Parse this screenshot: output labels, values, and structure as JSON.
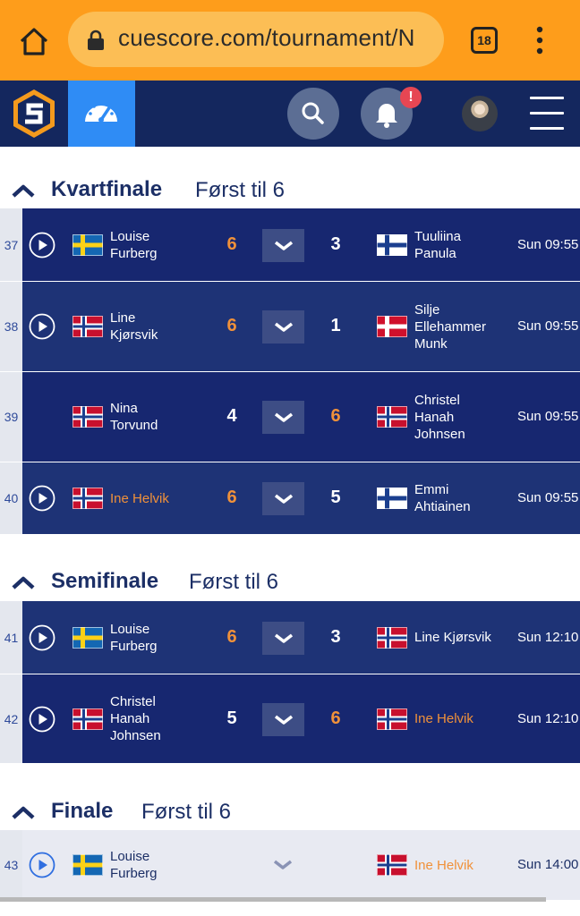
{
  "browser": {
    "url": "cuescore.com/tournament/N",
    "tab_count": "18"
  },
  "header": {
    "notification_badge": "!"
  },
  "colors": {
    "browser_bar": "#fe9d1b",
    "header_bg": "#14275e",
    "accent_blue": "#2f8cf5",
    "winner_orange": "#f0913a"
  },
  "sections": [
    {
      "title": "Kvartfinale",
      "rule": "Først til 6",
      "matches": [
        {
          "num": "37",
          "p1": "Louise\nFurberg",
          "p1_flag": "se",
          "s1": "6",
          "s2": "3",
          "p2": "Tuuliina\nPanula",
          "p2_flag": "fi",
          "time": "Sun 09:55",
          "has_play": true
        },
        {
          "num": "38",
          "p1": "Line\nKjørsvik",
          "p1_flag": "no",
          "s1": "6",
          "s2": "1",
          "p2": "Silje\nEllehammer\nMunk",
          "p2_flag": "dk",
          "time": "Sun 09:55",
          "has_play": true
        },
        {
          "num": "39",
          "p1": "Nina\nTorvund",
          "p1_flag": "no",
          "s1": "4",
          "s2": "6",
          "p2": "Christel\nHanah\nJohnsen",
          "p2_flag": "no",
          "time": "Sun 09:55",
          "has_play": false
        },
        {
          "num": "40",
          "p1": "Ine Helvik",
          "p1_flag": "no",
          "s1": "6",
          "s2": "5",
          "p2": "Emmi\nAhtiainen",
          "p2_flag": "fi",
          "time": "Sun 09:55",
          "has_play": true
        }
      ]
    },
    {
      "title": "Semifinale",
      "rule": "Først til 6",
      "matches": [
        {
          "num": "41",
          "p1": "Louise\nFurberg",
          "p1_flag": "se",
          "s1": "6",
          "s2": "3",
          "p2": "Line Kjørsvik",
          "p2_flag": "no",
          "time": "Sun 12:10",
          "has_play": true
        },
        {
          "num": "42",
          "p1": "Christel\nHanah\nJohnsen",
          "p1_flag": "no",
          "s1": "5",
          "s2": "6",
          "p2": "Ine Helvik",
          "p2_flag": "no",
          "time": "Sun 12:10",
          "has_play": true
        }
      ]
    },
    {
      "title": "Finale",
      "rule": "Først til 6",
      "matches": [
        {
          "num": "43",
          "p1": "Louise\nFurberg",
          "p1_flag": "se",
          "s1": "",
          "s2": "",
          "p2": "Ine Helvik",
          "p2_flag": "no",
          "time": "Sun 14:00",
          "has_play": true
        }
      ]
    }
  ]
}
